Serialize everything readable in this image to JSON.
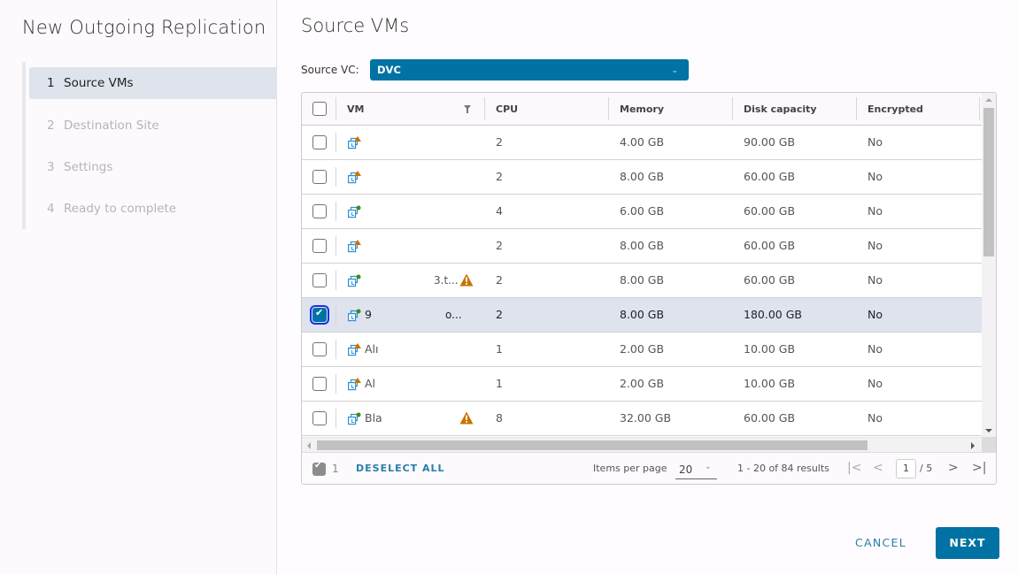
{
  "wizard": {
    "title": "New Outgoing Replication",
    "steps": [
      {
        "num": "1",
        "label": "Source VMs",
        "active": true
      },
      {
        "num": "2",
        "label": "Destination Site",
        "active": false
      },
      {
        "num": "3",
        "label": "Settings",
        "active": false
      },
      {
        "num": "4",
        "label": "Ready to complete",
        "active": false
      }
    ]
  },
  "page": {
    "title": "Source VMs",
    "source_vc_label": "Source VC:",
    "source_vc_value": "DVC",
    "chevron_icon": "chevron-down-icon"
  },
  "table": {
    "columns": [
      "VM",
      "CPU",
      "Memory",
      "Disk capacity",
      "Encrypted"
    ],
    "rows": [
      {
        "name": "",
        "extra": "",
        "status": "warning",
        "alert": false,
        "cpu": "2",
        "memory": "4.00 GB",
        "disk": "90.00 GB",
        "encrypted": "No",
        "selected": false
      },
      {
        "name": "",
        "extra": "",
        "status": "warning",
        "alert": false,
        "cpu": "2",
        "memory": "8.00 GB",
        "disk": "60.00 GB",
        "encrypted": "No",
        "selected": false
      },
      {
        "name": "",
        "extra": "",
        "status": "ok",
        "alert": false,
        "cpu": "4",
        "memory": "6.00 GB",
        "disk": "60.00 GB",
        "encrypted": "No",
        "selected": false
      },
      {
        "name": "",
        "extra": "",
        "status": "warning",
        "alert": false,
        "cpu": "2",
        "memory": "8.00 GB",
        "disk": "60.00 GB",
        "encrypted": "No",
        "selected": false
      },
      {
        "name": "",
        "extra": "3.t...",
        "status": "ok",
        "alert": true,
        "cpu": "2",
        "memory": "8.00 GB",
        "disk": "60.00 GB",
        "encrypted": "No",
        "selected": false
      },
      {
        "name": "9",
        "extra": "o...",
        "status": "ok",
        "alert": false,
        "cpu": "2",
        "memory": "8.00 GB",
        "disk": "180.00 GB",
        "encrypted": "No",
        "selected": true
      },
      {
        "name": "Alı",
        "extra": "",
        "status": "warning",
        "alert": false,
        "cpu": "1",
        "memory": "2.00 GB",
        "disk": "10.00 GB",
        "encrypted": "No",
        "selected": false
      },
      {
        "name": "Al",
        "extra": "",
        "status": "warning",
        "alert": false,
        "cpu": "1",
        "memory": "2.00 GB",
        "disk": "10.00 GB",
        "encrypted": "No",
        "selected": false
      },
      {
        "name": "Bla",
        "extra": "",
        "status": "ok",
        "alert": true,
        "cpu": "8",
        "memory": "32.00 GB",
        "disk": "60.00 GB",
        "encrypted": "No",
        "selected": false
      }
    ]
  },
  "footer": {
    "selected_count": "1",
    "deselect_all": "DESELECT ALL",
    "items_per_page_label": "Items per page",
    "items_per_page": "20",
    "range_text": "1 - 20 of 84 results",
    "current_page": "1",
    "total_pages": "/ 5"
  },
  "actions": {
    "cancel": "CANCEL",
    "next": "NEXT"
  },
  "colors": {
    "primary": "#0072a3",
    "warning": "#c77400",
    "ok": "#3c8d1e",
    "vm_icon": "#2f8fd0",
    "selected_row": "#dfe3ee"
  }
}
